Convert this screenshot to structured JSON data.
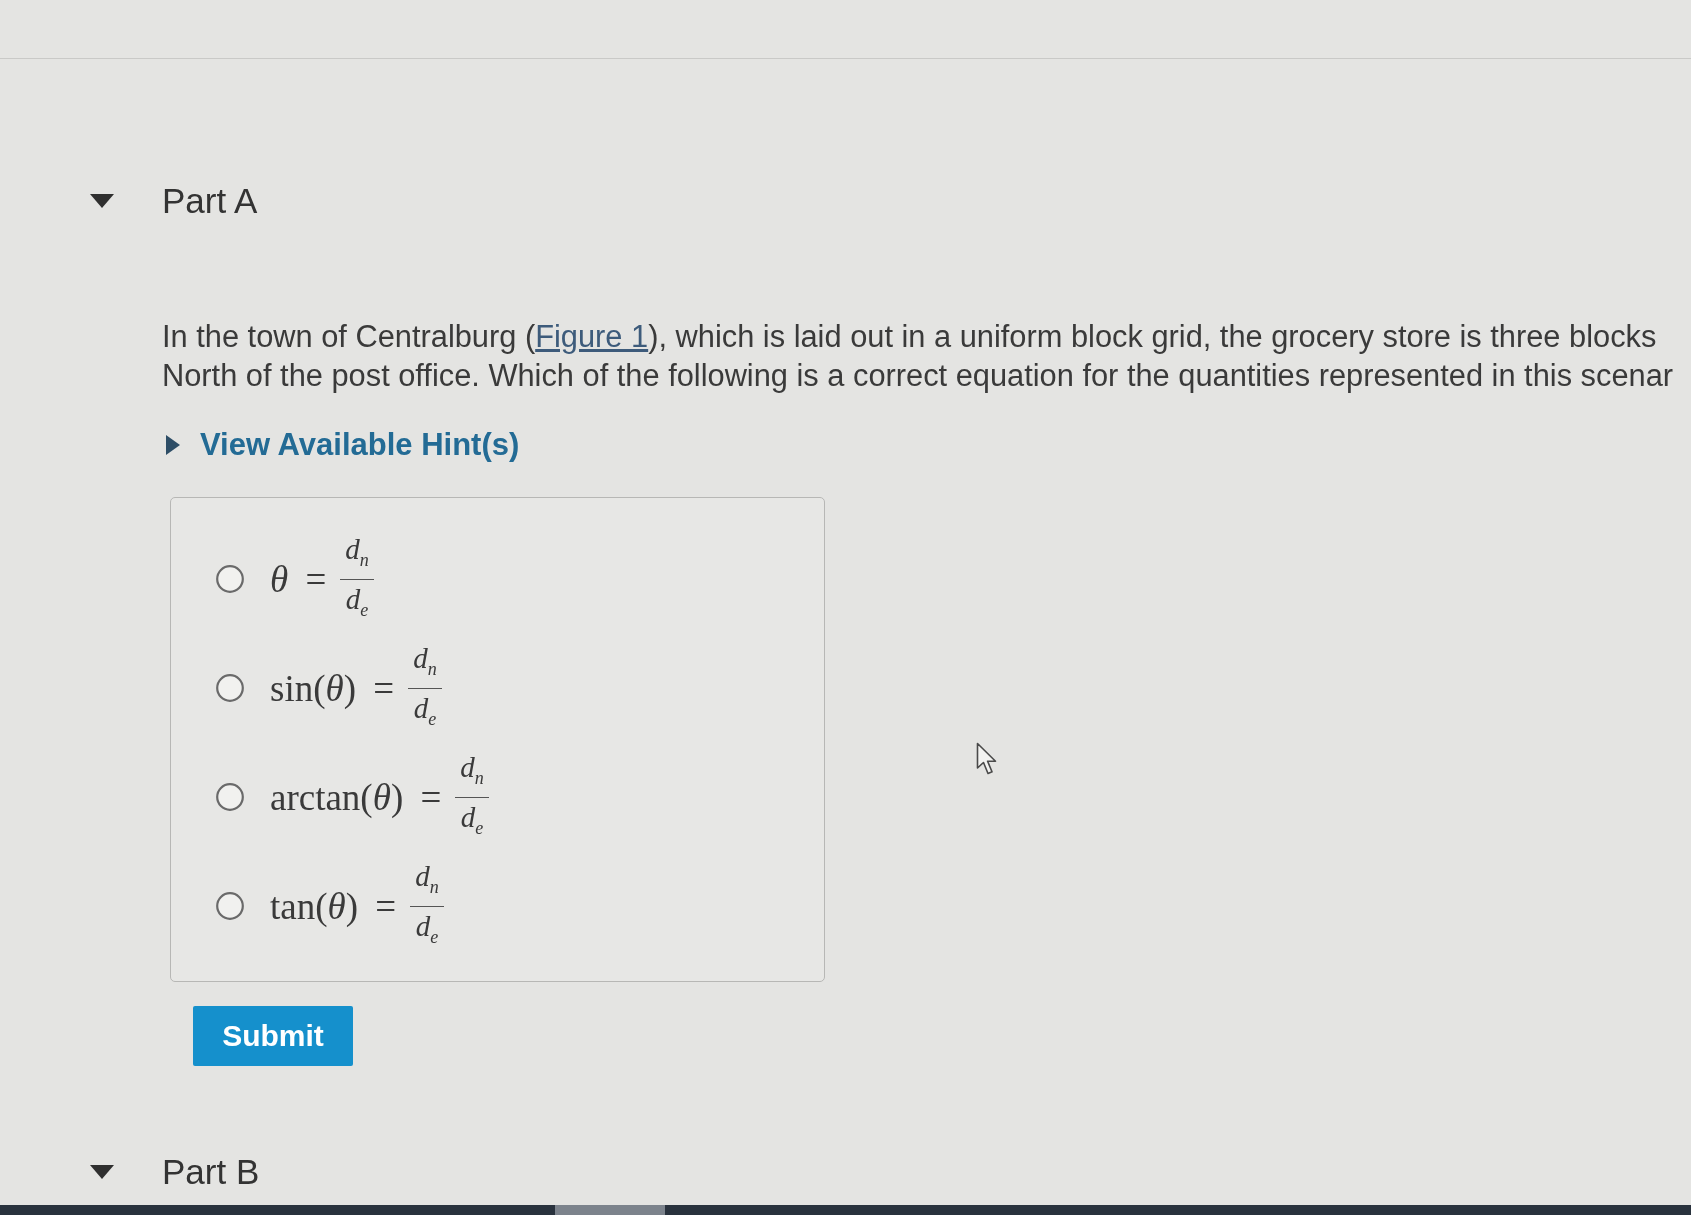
{
  "parts": [
    {
      "title": "Part A",
      "expanded": true,
      "question": {
        "lines": [
          {
            "before": "In the town of Centralburg (",
            "link": "Figure 1",
            "after": "), which is laid out in a uniform block grid, the grocery store is three blocks"
          },
          {
            "before": "North of the post office. Which of the following is a correct equation for the quantities represented in this scenar"
          }
        ]
      },
      "hint": {
        "label": "View Available Hint(s)",
        "expanded": false
      },
      "options": [
        {
          "lhs": "*θ* =",
          "numerator": "d$_{n}$",
          "denominator": "d$_{e}$",
          "selected": false
        },
        {
          "lhs": "sin(*θ*) =",
          "numerator": "d$_{n}$",
          "denominator": "d$_{e}$",
          "selected": false
        },
        {
          "lhs": "arctan(*θ*) =",
          "numerator": "d$_{n}$",
          "denominator": "d$_{e}$",
          "selected": false
        },
        {
          "lhs": "tan(*θ*) =",
          "numerator": "d$_{n}$",
          "denominator": "d$_{e}$",
          "selected": false
        }
      ],
      "submit": {
        "label": "Submit"
      }
    },
    {
      "title": "Part B",
      "expanded": true
    }
  ]
}
